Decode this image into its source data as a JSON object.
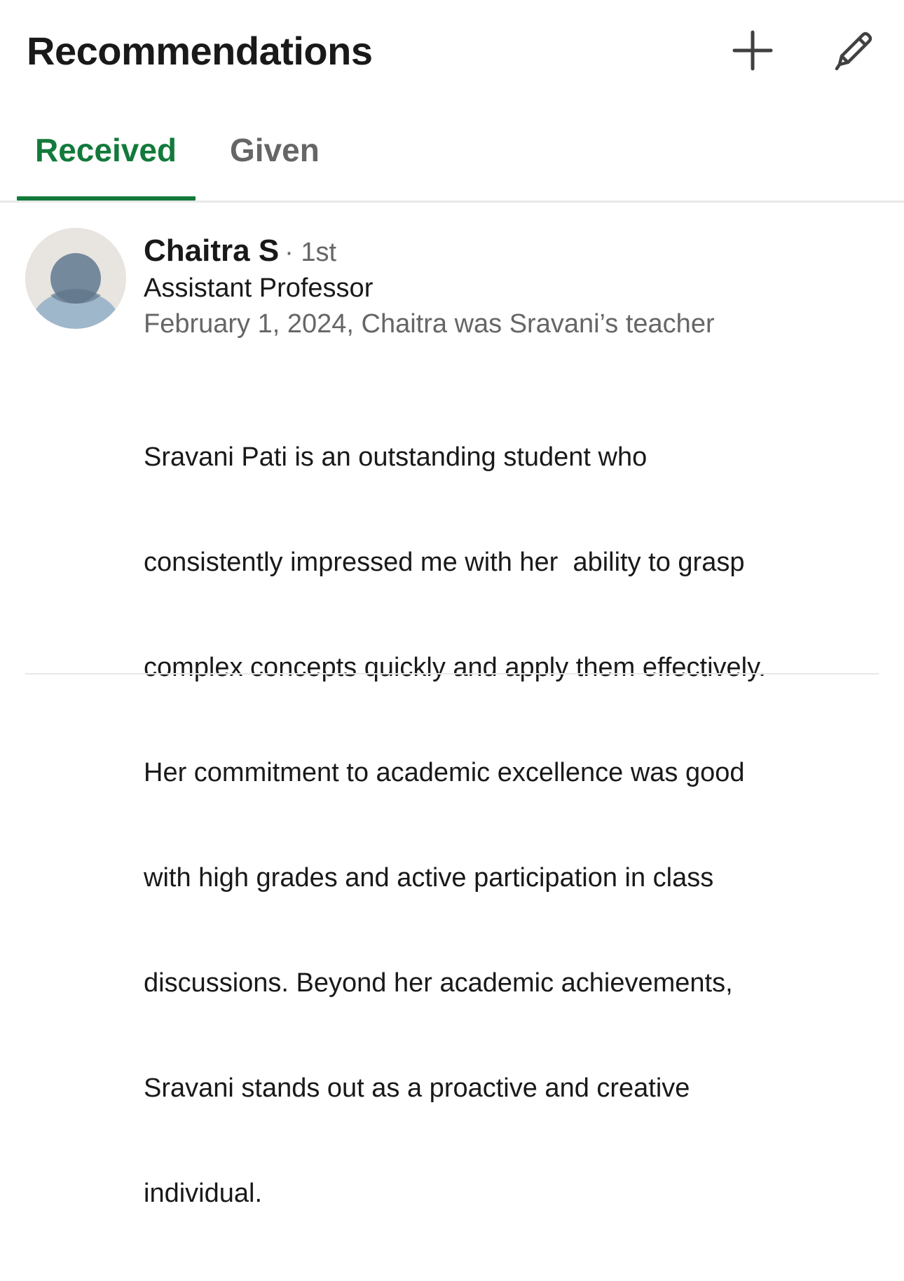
{
  "header": {
    "title": "Recommendations",
    "add_icon": "plus-icon",
    "edit_icon": "pencil-icon"
  },
  "tabs": [
    {
      "label": "Received",
      "active": true
    },
    {
      "label": "Given",
      "active": false
    }
  ],
  "colors": {
    "accent": "#137a3b",
    "text_primary": "#191919",
    "text_secondary": "#666666",
    "divider": "#e8e8e8"
  },
  "recommendation": {
    "name": "Chaitra S",
    "degree": "· 1st",
    "headline": "Assistant Professor",
    "meta": "February 1, 2024, Chaitra was Sravani’s teacher",
    "body_lines": [
      "Sravani Pati is an outstanding student who",
      "consistently impressed me with her  ability to grasp",
      "complex concepts quickly and apply them effectively.",
      "Her commitment to academic excellence was good",
      "with high grades and active participation in class",
      "discussions. Beyond her academic achievements,",
      "Sravani stands out as a proactive and creative",
      "individual."
    ]
  }
}
